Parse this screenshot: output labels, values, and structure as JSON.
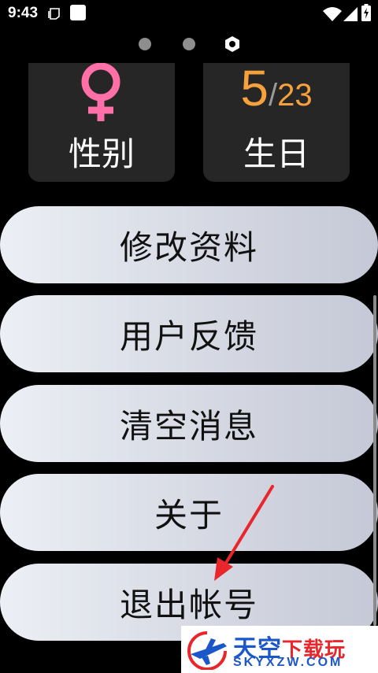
{
  "status_bar": {
    "time": "9:43"
  },
  "pager": {
    "pages": 3,
    "active_index": 2
  },
  "cards": {
    "gender": {
      "icon": "female-symbol-icon",
      "label": "性别",
      "icon_color": "#ff6fa8"
    },
    "birthday": {
      "month": "5",
      "separator": "/",
      "day": "23",
      "label": "生日",
      "value_color": "#f7a13c"
    }
  },
  "menu": {
    "items": [
      {
        "label": "修改资料"
      },
      {
        "label": "用户反馈"
      },
      {
        "label": "清空消息"
      },
      {
        "label": "关于"
      },
      {
        "label": "退出帐号"
      }
    ]
  },
  "watermark": {
    "title_main": "天空",
    "title_accent": "下载玩",
    "subtitle": "SKYXZW.COM"
  }
}
